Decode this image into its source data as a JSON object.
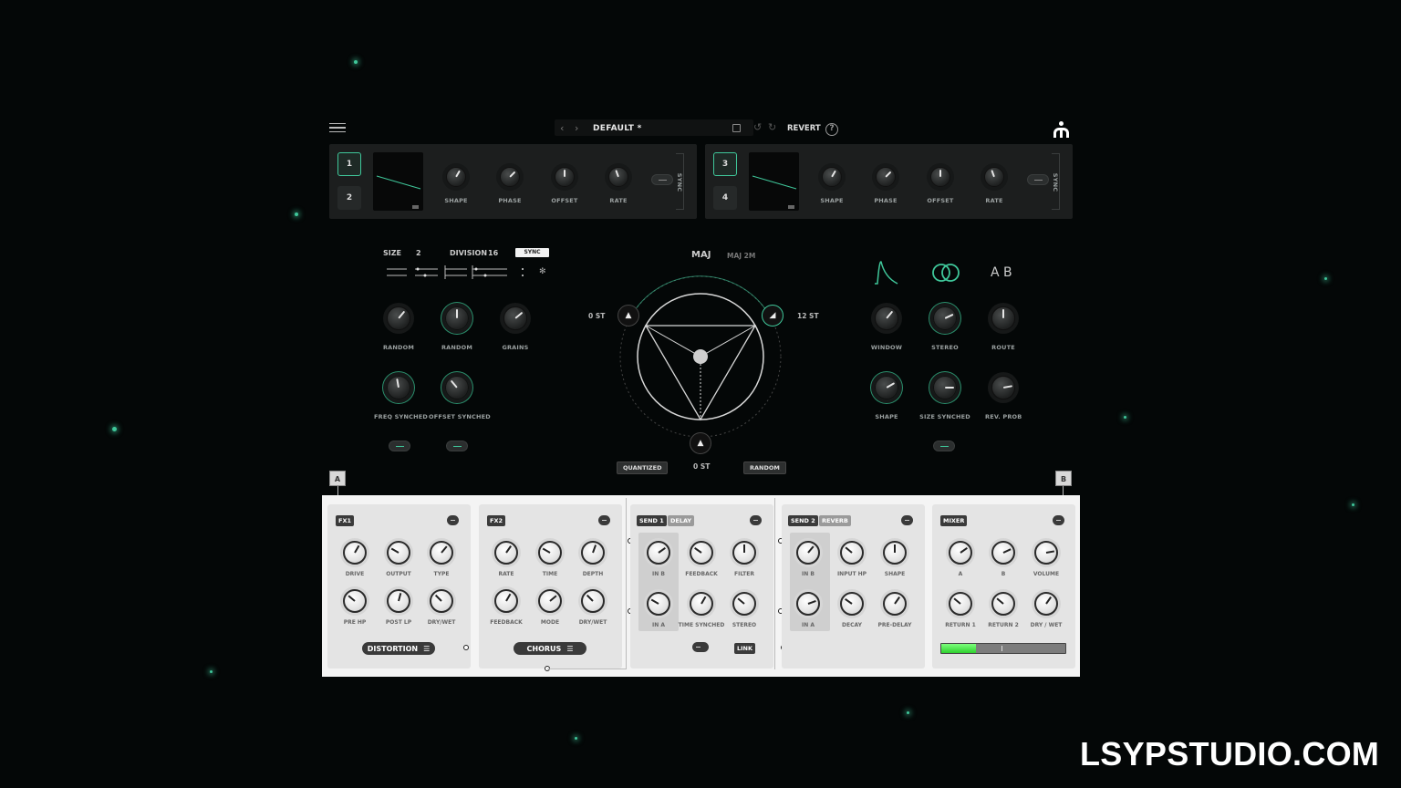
{
  "header": {
    "preset_name": "DEFAULT *",
    "revert_label": "REVERT",
    "help_label": "?"
  },
  "lfo_left": {
    "buttons": [
      "1",
      "2"
    ],
    "knobs": [
      "SHAPE",
      "PHASE",
      "OFFSET",
      "RATE"
    ],
    "sync_label": "SYNC"
  },
  "lfo_right": {
    "buttons": [
      "3",
      "4"
    ],
    "knobs": [
      "SHAPE",
      "PHASE",
      "OFFSET",
      "RATE"
    ],
    "sync_label": "SYNC"
  },
  "sequencer": {
    "size_label": "SIZE",
    "size_value": "2",
    "division_label": "DIVISION",
    "division_value": "16",
    "sync_label": "SYNC",
    "knobs_row1": [
      "RANDOM",
      "RANDOM",
      "GRAINS"
    ],
    "knobs_row2": [
      "FREQ SYNCHED",
      "OFFSET SYNCHED"
    ]
  },
  "pitch": {
    "scale_1": "MAJ",
    "scale_2": "MAJ 2M",
    "left_label": "0 ST",
    "right_label": "12 ST",
    "bottom_label": "0 ST",
    "quantized_label": "QUANTIZED",
    "random_label": "RANDOM"
  },
  "grain": {
    "ab_label": "A B",
    "knobs_row1": [
      "WINDOW",
      "STEREO",
      "ROUTE"
    ],
    "knobs_row2": [
      "SHAPE",
      "SIZE SYNCHED",
      "REV. PROB"
    ]
  },
  "routing": {
    "a_label": "A",
    "b_label": "B"
  },
  "fx1": {
    "tag": "FX1",
    "knobs_row1": [
      "DRIVE",
      "OUTPUT",
      "TYPE"
    ],
    "knobs_row2": [
      "PRE HP",
      "POST LP",
      "DRY/WET"
    ],
    "type_select": "DISTORTION"
  },
  "fx2": {
    "tag": "FX2",
    "knobs_row1": [
      "RATE",
      "TIME",
      "DEPTH"
    ],
    "knobs_row2": [
      "FEEDBACK",
      "MODE",
      "DRY/WET"
    ],
    "type_select": "CHORUS"
  },
  "send1": {
    "tag": "SEND 1",
    "type": "DELAY",
    "knobs_row1": [
      "IN B",
      "FEEDBACK",
      "FILTER"
    ],
    "knobs_row2": [
      "IN A",
      "TIME SYNCHED",
      "STEREO"
    ],
    "link_label": "LINK"
  },
  "send2": {
    "tag": "SEND 2",
    "type": "REVERB",
    "knobs_row1": [
      "IN B",
      "INPUT HP",
      "SHAPE"
    ],
    "knobs_row2": [
      "IN A",
      "DECAY",
      "PRE-DELAY"
    ]
  },
  "mixer": {
    "tag": "MIXER",
    "knobs_row1": [
      "A",
      "B",
      "VOLUME"
    ],
    "knobs_row2": [
      "RETURN 1",
      "RETURN 2",
      "DRY / WET"
    ],
    "meter_level": 0.28
  },
  "watermark": "LSYPSTUDIO.COM",
  "colors": {
    "accent": "#3fc79a",
    "panel": "#1a1c1c",
    "fx_panel": "#e4e4e4"
  }
}
